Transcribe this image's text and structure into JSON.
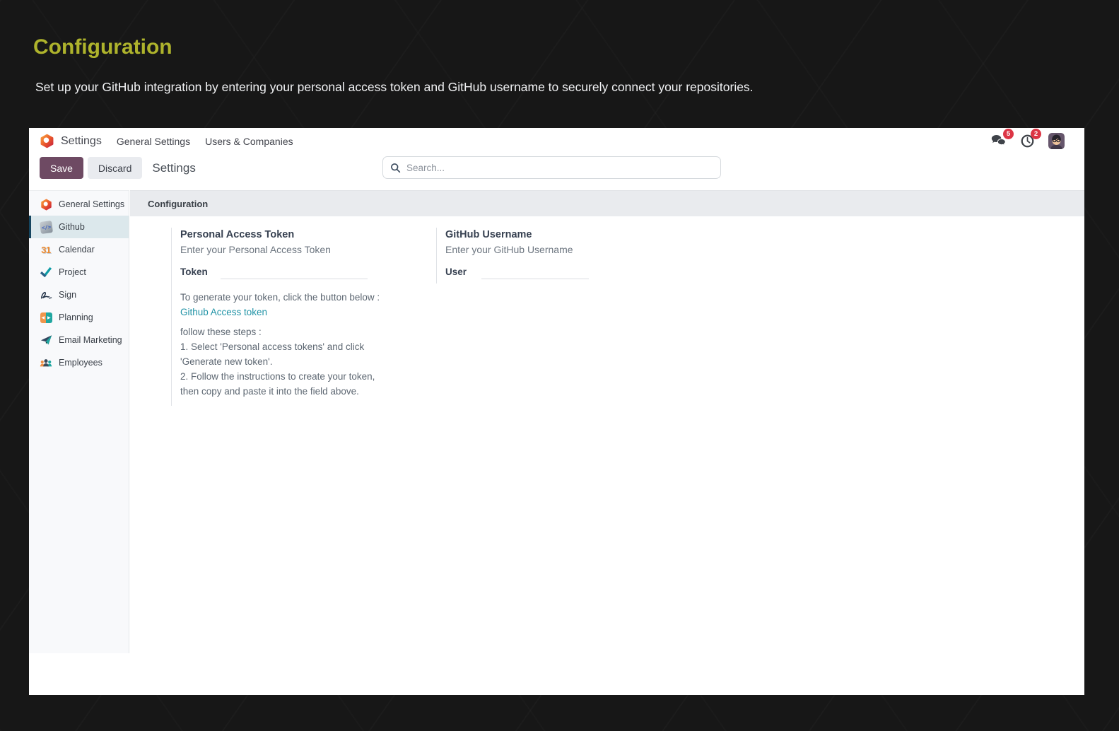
{
  "page": {
    "title": "Configuration",
    "description": "Set up your GitHub integration by entering your personal access token and GitHub username to securely connect your repositories."
  },
  "app": {
    "name": "Settings",
    "menus": [
      "General Settings",
      "Users & Companies"
    ],
    "notifications": {
      "messages": "5",
      "activities": "2"
    }
  },
  "toolbar": {
    "save_label": "Save",
    "discard_label": "Discard",
    "breadcrumb": "Settings",
    "search_placeholder": "Search..."
  },
  "sidebar": {
    "items": [
      {
        "label": "General Settings",
        "icon": "odoo-logo-icon",
        "selected": false
      },
      {
        "label": "Github",
        "icon": "github-code-icon",
        "selected": true
      },
      {
        "label": "Calendar",
        "icon": "calendar-31-icon",
        "selected": false
      },
      {
        "label": "Project",
        "icon": "check-icon",
        "selected": false
      },
      {
        "label": "Sign",
        "icon": "signature-icon",
        "selected": false
      },
      {
        "label": "Planning",
        "icon": "planning-arrows-icon",
        "selected": false
      },
      {
        "label": "Email Marketing",
        "icon": "paper-plane-icon",
        "selected": false
      },
      {
        "label": "Employees",
        "icon": "people-icon",
        "selected": false
      }
    ]
  },
  "main": {
    "section_header": "Configuration",
    "token_setting": {
      "title": "Personal Access Token",
      "subtitle": "Enter your Personal Access Token",
      "field_label": "Token",
      "help_intro": "To generate your token, click the button below :",
      "link_label": "Github Access token",
      "steps_intro": "follow these steps :",
      "steps": [
        "1. Select 'Personal access tokens' and click",
        "'Generate new token'.",
        "2. Follow the instructions to create your token,",
        "then copy and paste it into the field above."
      ]
    },
    "username_setting": {
      "title": "GitHub Username",
      "subtitle": "Enter your GitHub Username",
      "field_label": "User"
    }
  },
  "icons": {
    "github_glyph": "</>",
    "calendar_day": "31",
    "planning_left": "◀",
    "planning_right": "▶"
  },
  "colors": {
    "heading": "#aeb32c",
    "primary_button": "#6e4a63",
    "link": "#2093a6",
    "badge": "#dc3545",
    "selected_item_bg": "#dce8ec"
  }
}
